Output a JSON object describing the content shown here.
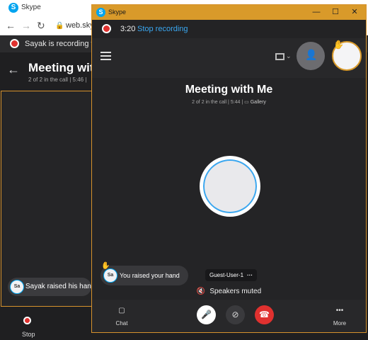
{
  "background_window": {
    "title": "Skype",
    "url": "web.skyp",
    "recording_notice": "Sayak is recording the",
    "meeting_title": "Meeting wit",
    "meeting_subtitle": "2 of 2 in the call | 5:46 |",
    "raised_hand_text": "Sayak raised his hand",
    "avatar_initials": "Sa",
    "stop_label": "Stop"
  },
  "window": {
    "title": "Skype",
    "controls": [
      "—",
      "☐",
      "✕"
    ]
  },
  "recording": {
    "elapsed": "3:20",
    "stop_label": "Stop recording"
  },
  "meeting": {
    "title": "Meeting with Me",
    "subtitle": "2 of 2 in the call | 5:44 |",
    "view_label": "Gallery"
  },
  "participants": {
    "self_status": "You raised your hand",
    "self_initials": "Sa",
    "remote_name": "Guest-User-1",
    "remote_more": "···",
    "audio_status": "Speakers muted"
  },
  "controls": {
    "chat_label": "Chat",
    "more_label": "More"
  },
  "colors": {
    "accent": "#d99a2a",
    "link": "#3aa7f0",
    "record_red": "#e0312f",
    "skype_blue": "#00a4ef"
  }
}
